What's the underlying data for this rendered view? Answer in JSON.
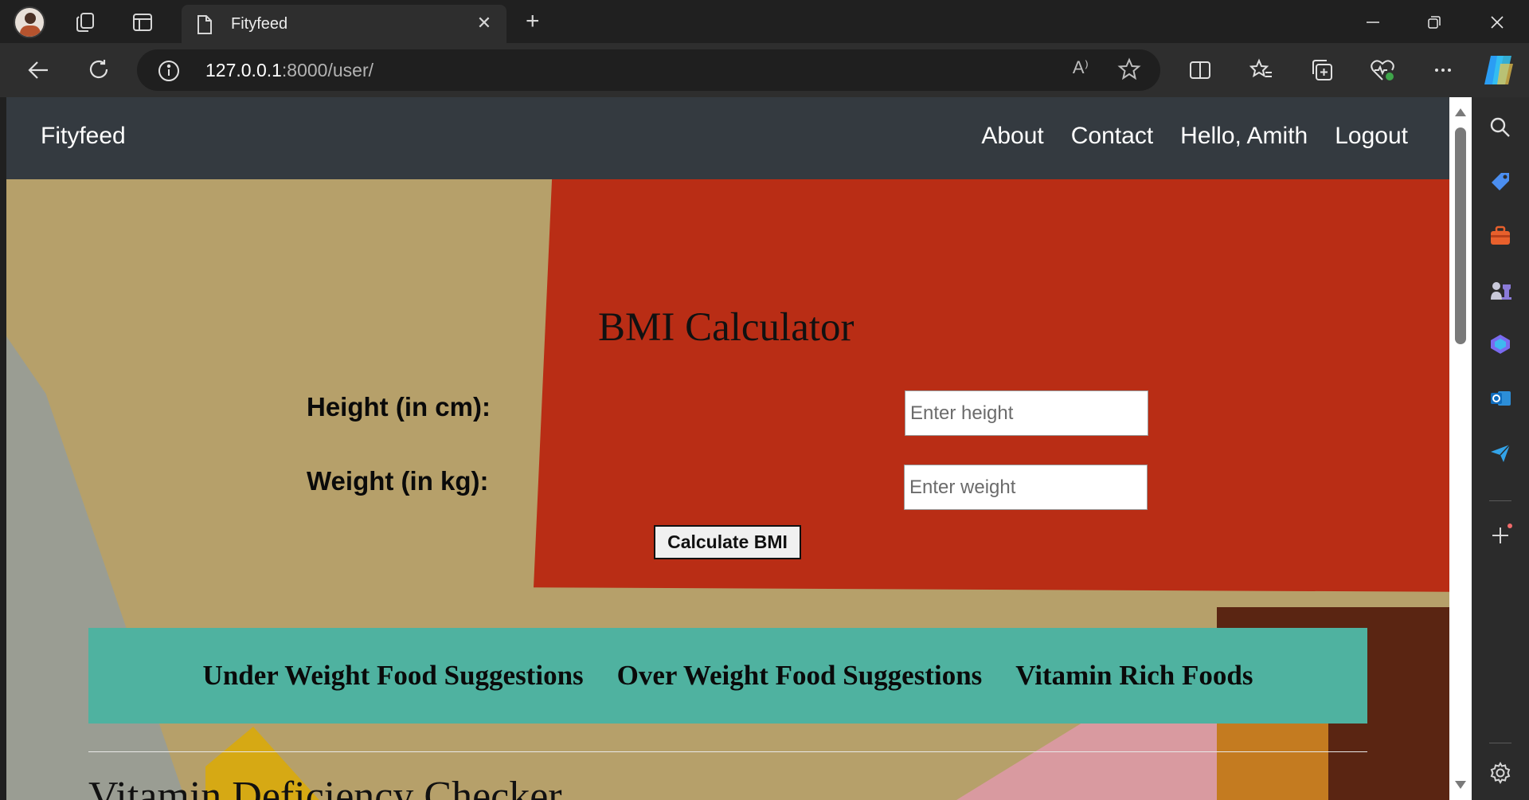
{
  "browser": {
    "tab_title": "Fityfeed",
    "url_host": "127.0.0.1",
    "url_rest": ":8000/user/",
    "read_aloud": "A⁾"
  },
  "site": {
    "brand": "Fityfeed",
    "nav": [
      "About",
      "Contact",
      "Hello, Amith",
      "Logout"
    ]
  },
  "bmi": {
    "title": "BMI Calculator",
    "height_label": "Height (in cm):",
    "height_placeholder": "Enter height",
    "weight_label": "Weight (in kg):",
    "weight_placeholder": "Enter weight",
    "button": "Calculate BMI"
  },
  "suggestions": [
    "Under Weight Food Suggestions",
    "Over Weight Food Suggestions",
    "Vitamin Rich Foods"
  ],
  "vitamin_title": "Vitamin Deficiency Checker",
  "colors": {
    "navbar": "#343a40",
    "suggestion_bar": "#4fb2a0",
    "hero_red": "#b92d15"
  }
}
